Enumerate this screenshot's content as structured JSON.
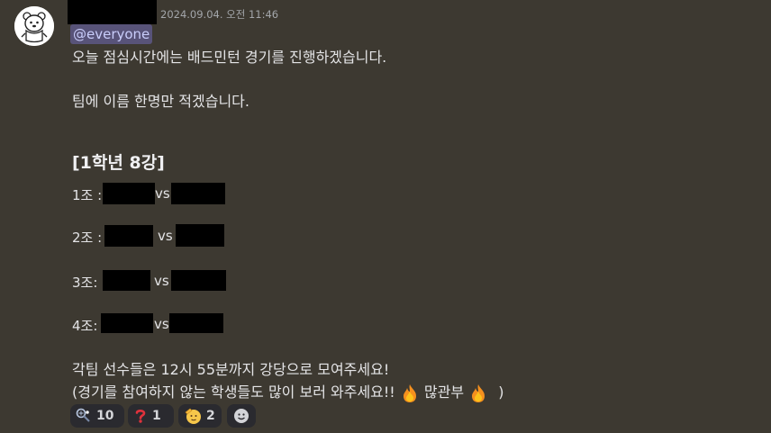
{
  "message": {
    "timestamp": "2024.09.04. 오전 11:46",
    "mention": "@everyone",
    "line1": "오늘 점심시간에는 배드민턴 경기를 진행하겠습니다.",
    "line2": "팀에 이름 한명만 적겠습니다.",
    "heading": "[1학년 8강]",
    "teams": [
      {
        "label": "1조 :",
        "vs": "vs"
      },
      {
        "label": "2조 :",
        "vs": "vs"
      },
      {
        "label": "3조:",
        "vs": "vs"
      },
      {
        "label": "4조:",
        "vs": "vs"
      }
    ],
    "closing1": "각팀 선수들은 12시 55분까지 강당으로 모여주세요!",
    "closing2_prefix": "(경기를 참여하지 않는 학생들도 많이 보러 와주세요!!",
    "closing2_word": "많관부",
    "closing2_suffix": ")"
  },
  "reactions": [
    {
      "icon": "badminton-icon",
      "count": "10"
    },
    {
      "icon": "question-mark-icon",
      "count": "1"
    },
    {
      "icon": "saluting-face-icon",
      "count": "2"
    },
    {
      "icon": "add-reaction-icon",
      "count": ""
    }
  ]
}
